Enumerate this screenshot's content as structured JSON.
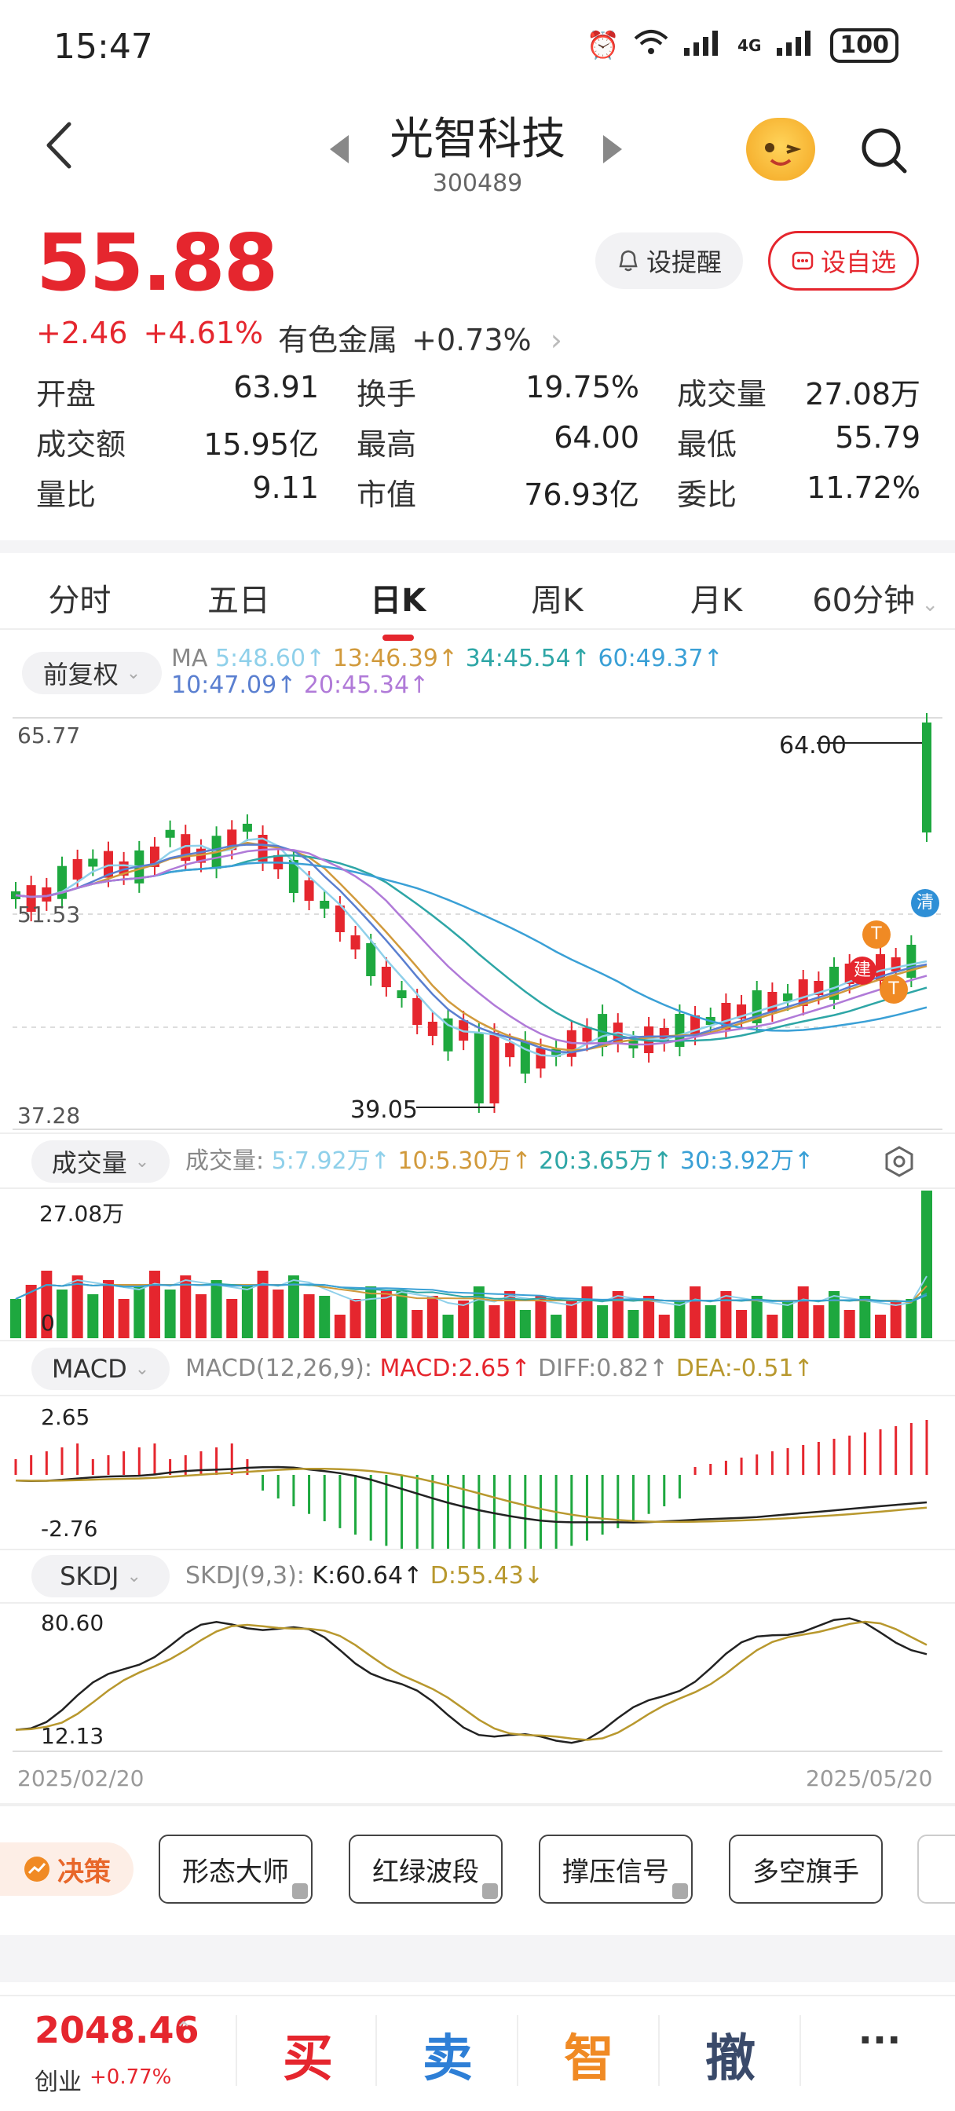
{
  "status_bar": {
    "time": "15:47",
    "network": "4G",
    "battery": "100"
  },
  "header": {
    "title": "光智科技",
    "code": "300489"
  },
  "price": {
    "current": "55.88",
    "change": "+2.46",
    "change_pct": "+4.61%",
    "sector": "有色金属",
    "sector_chg": "+0.73%",
    "remind_label": "设提醒",
    "fav_label": "设自选"
  },
  "stats": [
    [
      {
        "label": "开盘",
        "value": "63.91",
        "color": "red"
      },
      {
        "label": "换手",
        "value": "19.75%",
        "color": "black"
      },
      {
        "label": "成交量",
        "value": "27.08万",
        "color": "black"
      }
    ],
    [
      {
        "label": "成交额",
        "value": "15.95亿",
        "color": "black"
      },
      {
        "label": "最高",
        "value": "64.00",
        "color": "red"
      },
      {
        "label": "最低",
        "value": "55.79",
        "color": "red"
      }
    ],
    [
      {
        "label": "量比",
        "value": "9.11",
        "color": "black"
      },
      {
        "label": "市值",
        "value": "76.93亿",
        "color": "black"
      },
      {
        "label": "委比",
        "value": "11.72%",
        "color": "red"
      }
    ]
  ],
  "tabs": [
    "分时",
    "五日",
    "日K",
    "周K",
    "月K",
    "60分钟"
  ],
  "active_tab": "日K",
  "ma": {
    "adjust_label": "前复权",
    "prefix": "MA",
    "items": [
      {
        "text": "5:48.60↑",
        "color": "#8fd0ea"
      },
      {
        "text": "13:46.39↑",
        "color": "#d19a3c"
      },
      {
        "text": "34:45.54↑",
        "color": "#2ea6a6"
      },
      {
        "text": "60:49.37↑",
        "color": "#3aa0d6"
      },
      {
        "text": "10:47.09↑",
        "color": "#5a7fd0"
      },
      {
        "text": "20:45.34↑",
        "color": "#b07ad8"
      }
    ]
  },
  "kline": {
    "y_top": "65.77",
    "y_mid": "51.53",
    "y_bottom": "37.28",
    "high_label": "64.00",
    "low_label": "39.05",
    "badges": {
      "t": "T",
      "jian": "建",
      "qing": "清"
    }
  },
  "volume": {
    "label": "成交量",
    "prefix": "成交量:",
    "items": [
      {
        "text": "5:7.92万↑",
        "color": "#8fd0ea"
      },
      {
        "text": "10:5.30万↑",
        "color": "#d19a3c"
      },
      {
        "text": "20:3.65万↑",
        "color": "#2ea6a6"
      },
      {
        "text": "30:3.92万↑",
        "color": "#3aa0d6"
      }
    ],
    "max_label": "27.08万",
    "zero_label": "0"
  },
  "macd": {
    "label": "MACD",
    "params": "MACD(12,26,9):",
    "macd": "MACD:2.65↑",
    "diff": "DIFF:0.82↑",
    "dea": "DEA:-0.51↑",
    "y_top": "2.65",
    "y_bottom": "-2.76"
  },
  "skdj": {
    "label": "SKDJ",
    "params": "SKDJ(9,3):",
    "k": "K:60.64↑",
    "d": "D:55.43↓",
    "y_top": "80.60",
    "y_bottom": "12.13"
  },
  "dates": {
    "start": "2025/02/20",
    "end": "2025/05/20"
  },
  "strategy": {
    "decision_label": "决策",
    "tools": [
      "形态大师",
      "红绿波段",
      "撑压信号",
      "多空旗手"
    ]
  },
  "bottom": {
    "index_value": "2048.46",
    "index_name": "创业",
    "index_change": "+0.77%",
    "buy": "买",
    "sell": "卖",
    "smart": "智",
    "cancel": "撤",
    "more": "···"
  },
  "colors": {
    "up": "#e5262e",
    "down": "#1ea83f",
    "accent": "#e5262e"
  }
}
